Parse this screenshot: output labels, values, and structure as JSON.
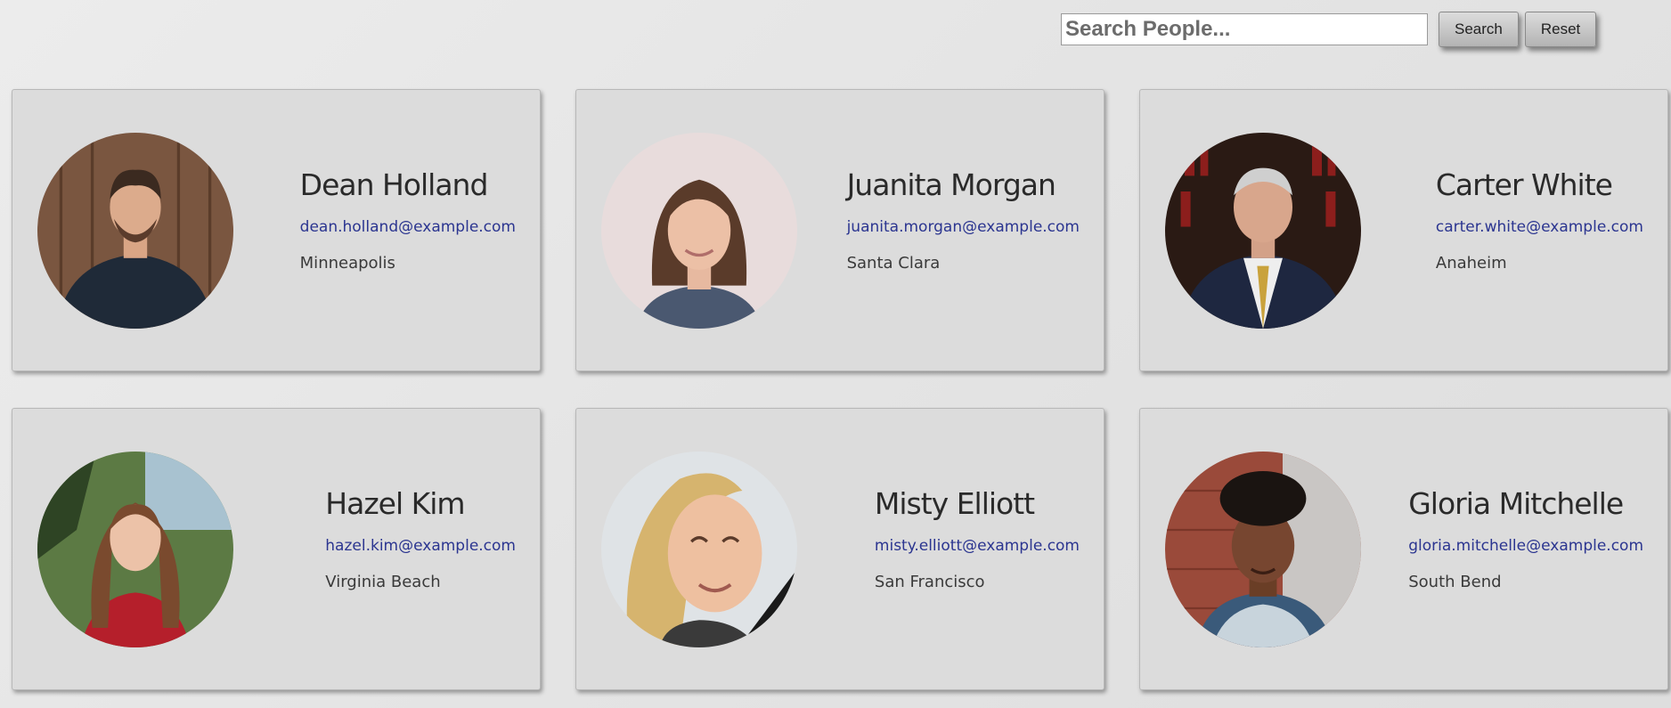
{
  "search": {
    "placeholder": "Search People...",
    "search_label": "Search",
    "reset_label": "Reset"
  },
  "people": [
    {
      "name": "Dean Holland",
      "email": "dean.holland@example.com",
      "city": "Minneapolis"
    },
    {
      "name": "Juanita Morgan",
      "email": "juanita.morgan@example.com",
      "city": "Santa Clara"
    },
    {
      "name": "Carter White",
      "email": "carter.white@example.com",
      "city": "Anaheim"
    },
    {
      "name": "Hazel Kim",
      "email": "hazel.kim@example.com",
      "city": "Virginia Beach"
    },
    {
      "name": "Misty Elliott",
      "email": "misty.elliott@example.com",
      "city": "San Francisco"
    },
    {
      "name": "Gloria Mitchelle",
      "email": "gloria.mitchelle@example.com",
      "city": "South Bend"
    }
  ]
}
